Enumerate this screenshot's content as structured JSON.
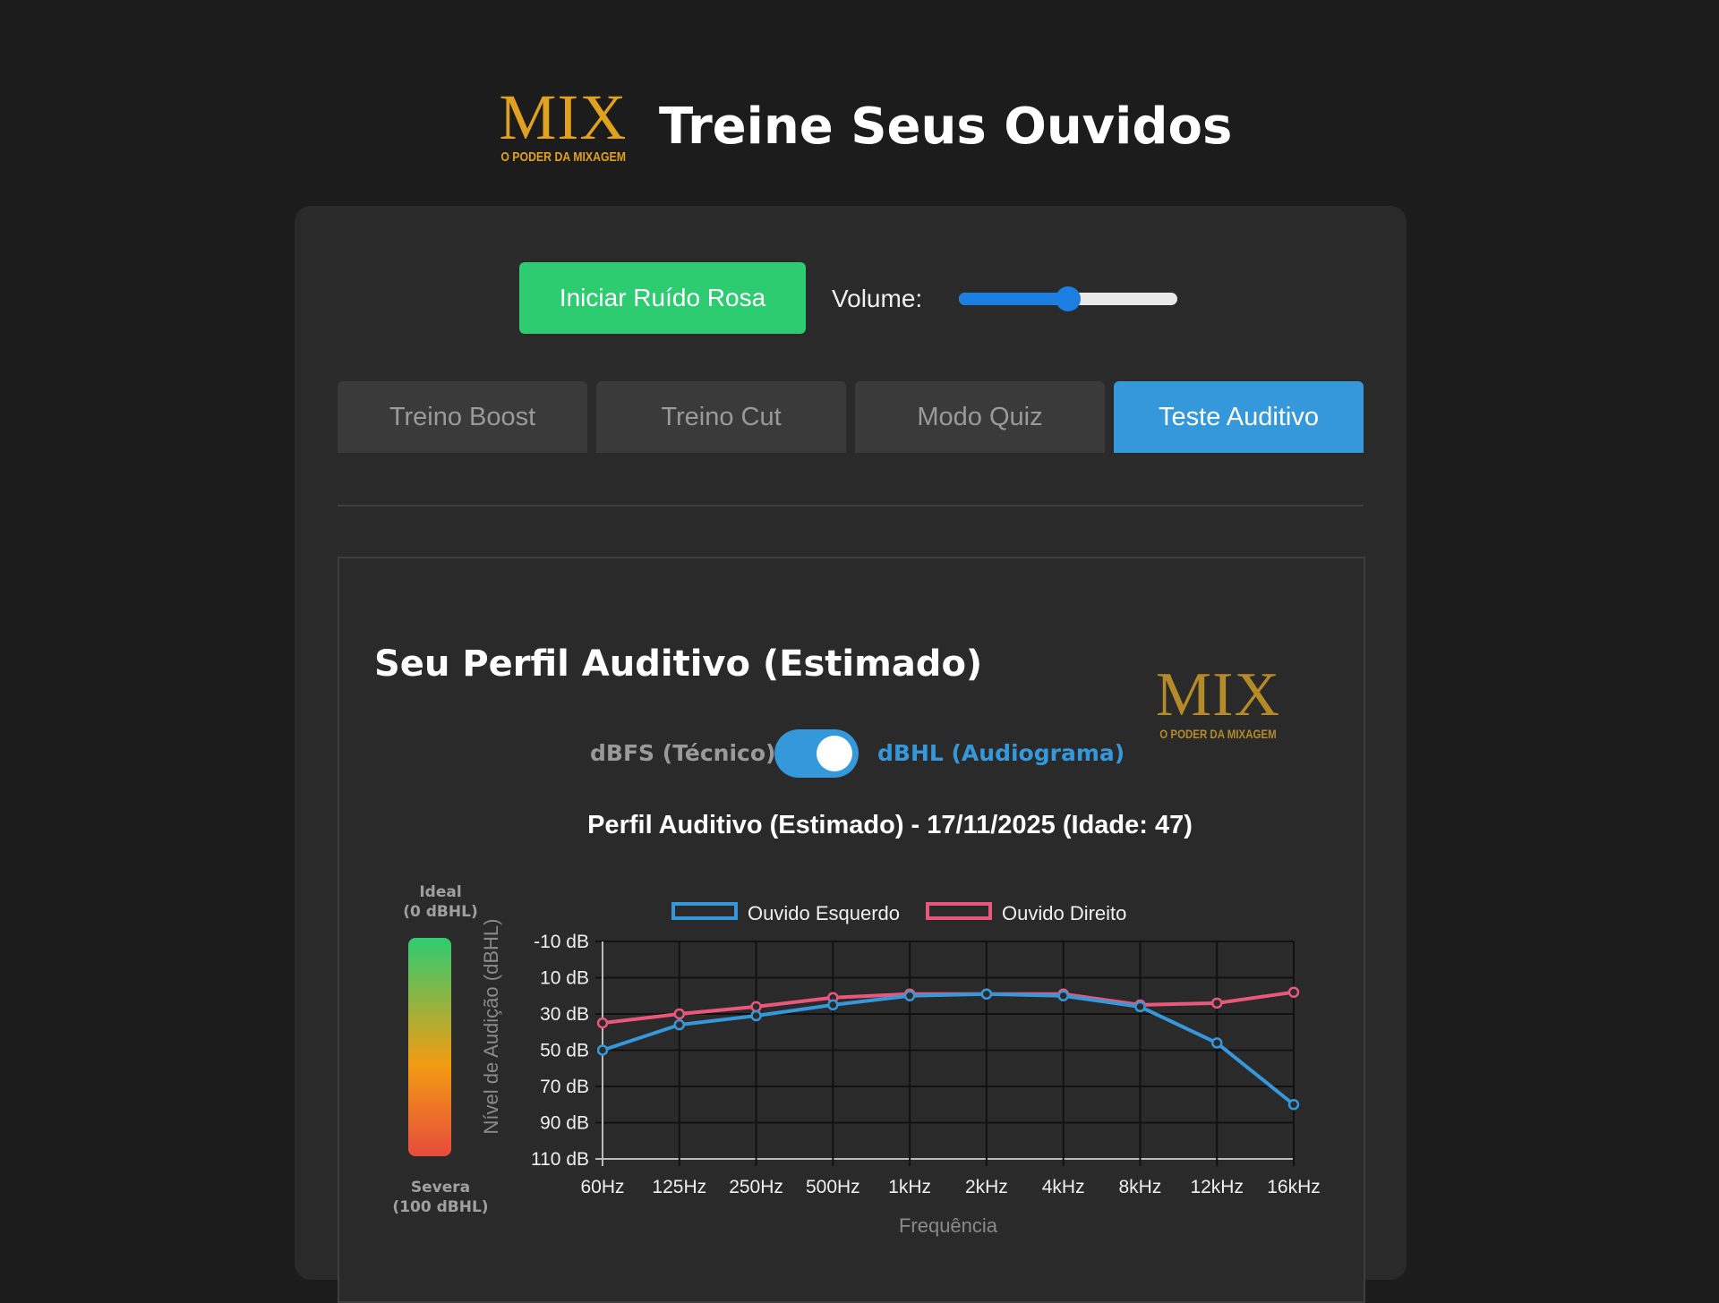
{
  "header": {
    "logo_main": "MIX",
    "logo_sub": "O PODER DA MIXAGEM",
    "title": "Treine Seus Ouvidos"
  },
  "controls": {
    "play_button": "Iniciar Ruído Rosa",
    "volume_label": "Volume:",
    "volume_value": 0.5
  },
  "tabs": [
    {
      "label": "Treino Boost",
      "active": false
    },
    {
      "label": "Treino Cut",
      "active": false
    },
    {
      "label": "Modo Quiz",
      "active": false
    },
    {
      "label": "Teste Auditivo",
      "active": true
    }
  ],
  "profile": {
    "title": "Seu Perfil Auditivo (Estimado)",
    "logo_main": "MIX",
    "logo_sub": "O PODER DA MIXAGEM",
    "mode_left": "dBFS (Técnico)",
    "mode_right": "dBHL (Audiograma)",
    "mode_on": true,
    "scale_top": "Ideal",
    "scale_top_sub": "(0 dBHL)",
    "scale_bottom": "Severa",
    "scale_bottom_sub": "(100 dBHL)"
  },
  "colors": {
    "accent": "#3498db",
    "play": "#2ecc71",
    "left_ear": "#3498db",
    "right_ear": "#e9587a"
  },
  "chart_data": {
    "type": "line",
    "title": "Perfil Auditivo (Estimado) - 17/11/2025 (Idade: 47)",
    "xlabel": "Frequência",
    "ylabel": "Nível de Audição (dBHL)",
    "categories": [
      "60Hz",
      "125Hz",
      "250Hz",
      "500Hz",
      "1kHz",
      "2kHz",
      "4kHz",
      "8kHz",
      "12kHz",
      "16kHz"
    ],
    "yticks": [
      "-10 dB",
      "10 dB",
      "30 dB",
      "50 dB",
      "70 dB",
      "90 dB",
      "110 dB"
    ],
    "ylim": [
      -10,
      110
    ],
    "y_reversed": true,
    "legend_position": "top",
    "grid": true,
    "series": [
      {
        "name": "Ouvido Esquerdo",
        "values": [
          50,
          36,
          31,
          25,
          20,
          19,
          20,
          26,
          46,
          80
        ]
      },
      {
        "name": "Ouvido Direito",
        "values": [
          35,
          30,
          26,
          21,
          19,
          19,
          19,
          25,
          24,
          18
        ]
      }
    ]
  }
}
